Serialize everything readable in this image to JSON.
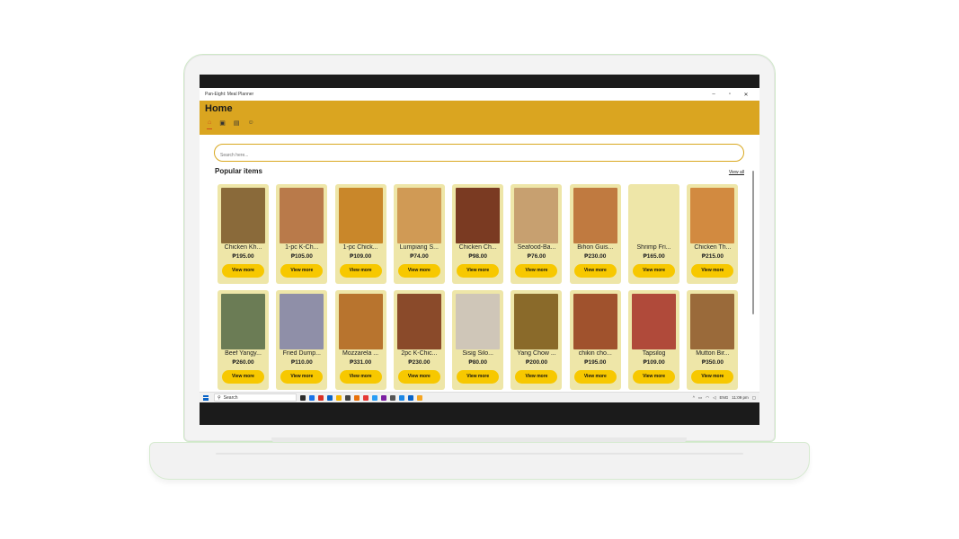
{
  "window": {
    "title": "Pan-Eight: Meal Planner",
    "minimize": "–",
    "maximize": "▫",
    "close": "✕"
  },
  "header": {
    "title": "Home"
  },
  "nav": [
    {
      "icon": "home-icon",
      "glyph": "⌂"
    },
    {
      "icon": "calendar-icon",
      "glyph": "▣"
    },
    {
      "icon": "clipboard-icon",
      "glyph": "▤"
    },
    {
      "icon": "profile-icon",
      "glyph": "☺"
    }
  ],
  "search": {
    "placeholder": "Search here..."
  },
  "popular": {
    "title": "Popular items",
    "view_all": "View all"
  },
  "button_label": "View more",
  "items_row1": [
    {
      "name": "Chicken Kh...",
      "price": "₱195.00",
      "color": "#8a6a3a"
    },
    {
      "name": "1-pc  K-Ch...",
      "price": "₱105.00",
      "color": "#b97a4a"
    },
    {
      "name": "1-pc Chick...",
      "price": "₱109.00",
      "color": "#c9872a"
    },
    {
      "name": "Lumpiang S...",
      "price": "₱74.00",
      "color": "#d09a55"
    },
    {
      "name": "Chicken Ch...",
      "price": "₱98.00",
      "color": "#7a3a22"
    },
    {
      "name": "Seafood-Ba...",
      "price": "₱76.00",
      "color": "#c7a070"
    },
    {
      "name": "Bihon Guis...",
      "price": "₱230.00",
      "color": "#c07a40"
    },
    {
      "name": "Shrimp Fri...",
      "price": "₱165.00",
      "color": "#eee6a8"
    },
    {
      "name": "Chicken Th...",
      "price": "₱215.00",
      "color": "#d28a40"
    }
  ],
  "items_row2": [
    {
      "name": "Beef Yangy...",
      "price": "₱260.00",
      "color": "#6b7c55"
    },
    {
      "name": "Fried Dump...",
      "price": "₱110.00",
      "color": "#8f8fa8"
    },
    {
      "name": "Mozzarela ...",
      "price": "₱331.00",
      "color": "#b8742e"
    },
    {
      "name": "2pc K-Chic...",
      "price": "₱230.00",
      "color": "#8a4a2a"
    },
    {
      "name": "Sisig Silo...",
      "price": "₱80.00",
      "color": "#cfc6b8"
    },
    {
      "name": "Yang Chow ...",
      "price": "₱200.00",
      "color": "#8a6a2a"
    },
    {
      "name": "chikin cho...",
      "price": "₱195.00",
      "color": "#a0522d"
    },
    {
      "name": "Tapsilog",
      "price": "₱109.00",
      "color": "#b04a3a"
    },
    {
      "name": "Mutton Bir...",
      "price": "₱350.00",
      "color": "#9a6a3a"
    }
  ],
  "taskbar": {
    "search_label": "Search",
    "lang": "ENG",
    "time": "11:09 pm"
  },
  "taskbar_app_colors": [
    "#2b2b2b",
    "#1a73e8",
    "#d93025",
    "#0a64c8",
    "#f4b400",
    "#444",
    "#e8710a",
    "#e53935",
    "#2a9df4",
    "#7b1fa2",
    "#555",
    "#1e88e5",
    "#0a64c8",
    "#f5a623"
  ]
}
